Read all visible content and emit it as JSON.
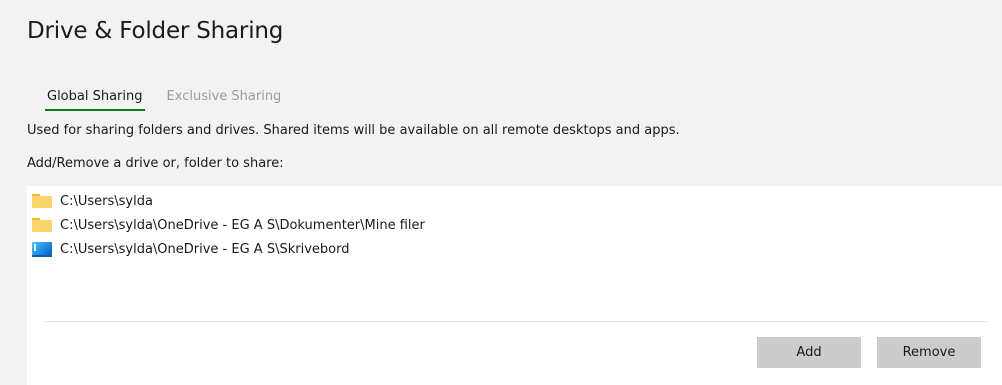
{
  "page": {
    "title": "Drive & Folder Sharing"
  },
  "tabs": [
    {
      "label": "Global Sharing",
      "active": true
    },
    {
      "label": "Exclusive Sharing",
      "active": false
    }
  ],
  "description": "Used for sharing folders and drives. Shared items will be available on all remote desktops and apps.",
  "list_label": "Add/Remove a drive or, folder to share:",
  "shared_items": [
    {
      "path": "C:\\Users\\sylda",
      "icon": "folder-icon"
    },
    {
      "path": "C:\\Users\\sylda\\OneDrive - EG A S\\Dokumenter\\Mine filer",
      "icon": "folder-icon"
    },
    {
      "path": "C:\\Users\\sylda\\OneDrive - EG A S\\Skrivebord",
      "icon": "desktop-folder-icon"
    }
  ],
  "buttons": {
    "add_label": "Add",
    "remove_label": "Remove"
  },
  "colors": {
    "accent": "#107c10",
    "background": "#f2f2f2",
    "panel": "#ffffff",
    "button": "#cccccc"
  }
}
